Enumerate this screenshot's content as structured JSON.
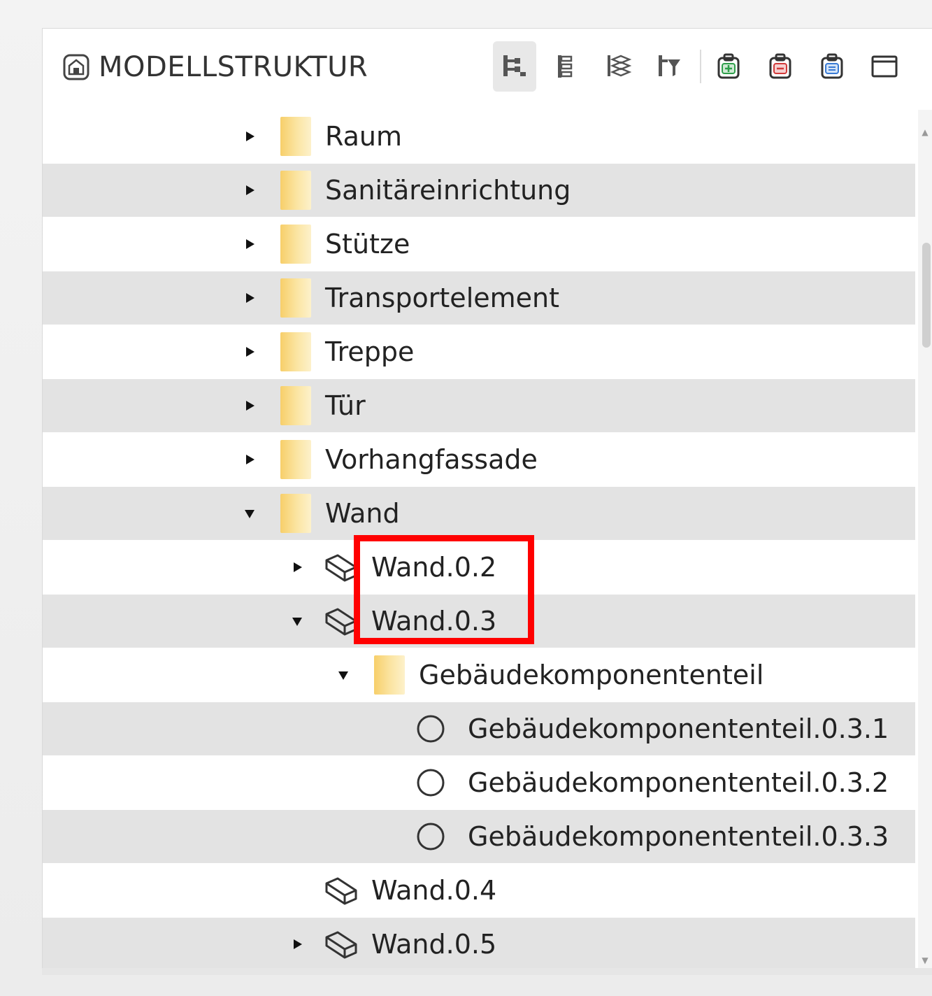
{
  "panel": {
    "title": "MODELLSTRUKTUR",
    "title_icon": "building-model-icon"
  },
  "toolbar": {
    "buttons": [
      {
        "icon": "tree-hierarchy-icon",
        "active": true
      },
      {
        "icon": "tree-flat-icon",
        "active": false
      },
      {
        "icon": "layers-tree-icon",
        "active": false
      },
      {
        "icon": "tree-filter-icon",
        "active": false
      },
      {
        "icon": "clipboard-add-icon",
        "color": "#2e9e4a"
      },
      {
        "icon": "clipboard-remove-icon",
        "color": "#d23a3a"
      },
      {
        "icon": "clipboard-list-icon",
        "color": "#3a7bd5"
      },
      {
        "icon": "window-icon"
      }
    ]
  },
  "tree": {
    "rows": [
      {
        "label": "Raum",
        "icon": "folder",
        "toggle": "collapsed",
        "level": 0
      },
      {
        "label": "Sanitäreinrichtung",
        "icon": "folder",
        "toggle": "collapsed",
        "level": 0
      },
      {
        "label": "Stütze",
        "icon": "folder",
        "toggle": "collapsed",
        "level": 0
      },
      {
        "label": "Transportelement",
        "icon": "folder",
        "toggle": "collapsed",
        "level": 0
      },
      {
        "label": "Treppe",
        "icon": "folder",
        "toggle": "collapsed",
        "level": 0
      },
      {
        "label": "Tür",
        "icon": "folder",
        "toggle": "collapsed",
        "level": 0
      },
      {
        "label": "Vorhangfassade",
        "icon": "folder",
        "toggle": "collapsed",
        "level": 0
      },
      {
        "label": "Wand",
        "icon": "folder",
        "toggle": "expanded",
        "level": 0
      },
      {
        "label": "Wand.0.2",
        "icon": "element",
        "toggle": "collapsed",
        "level": 1
      },
      {
        "label": "Wand.0.3",
        "icon": "element",
        "toggle": "expanded",
        "level": 1
      },
      {
        "label": "Gebäudekomponententeil",
        "icon": "folder",
        "toggle": "expanded",
        "level": 2
      },
      {
        "label": "Gebäudekomponententeil.0.3.1",
        "icon": "circle",
        "toggle": "none",
        "level": 3
      },
      {
        "label": "Gebäudekomponententeil.0.3.2",
        "icon": "circle",
        "toggle": "none",
        "level": 3
      },
      {
        "label": "Gebäudekomponententeil.0.3.3",
        "icon": "circle",
        "toggle": "none",
        "level": 3
      },
      {
        "label": "Wand.0.4",
        "icon": "element",
        "toggle": "none",
        "level": 1
      },
      {
        "label": "Wand.0.5",
        "icon": "element",
        "toggle": "collapsed",
        "level": 1
      }
    ]
  },
  "annotation": {
    "color": "#ff0000"
  }
}
